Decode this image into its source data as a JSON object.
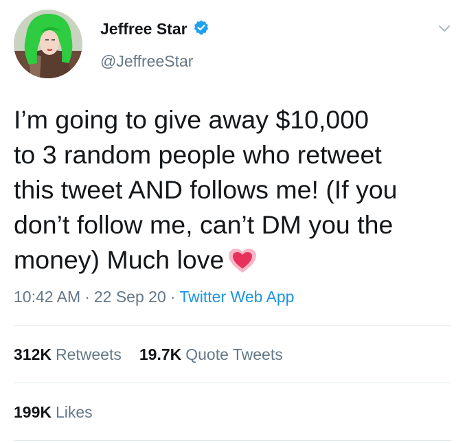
{
  "author": {
    "display_name": "Jeffree Star",
    "handle": "@JeffreeStar",
    "verified": true
  },
  "tweet": {
    "text": "I’m going to give away $10,000\nto 3 random people who retweet\nthis tweet AND follows me! (If you\ndon’t follow me, can’t DM you the\nmoney) Much love",
    "emoji": "heart-emoji",
    "time": "10:42 AM",
    "date": "22 Sep 20",
    "source": "Twitter Web App",
    "separator": "·"
  },
  "stats": {
    "retweets_count": "312K",
    "retweets_label": "Retweets",
    "quote_tweets_count": "19.7K",
    "quote_tweets_label": "Quote Tweets",
    "likes_count": "199K",
    "likes_label": "Likes"
  },
  "colors": {
    "text": "#14171a",
    "secondary": "#657786",
    "link": "#1b95e0",
    "verified": "#1da1f2",
    "divider": "#e1e8ed",
    "avatar_hair": "#2ecc40"
  },
  "icons": {
    "verified": "verified-badge-icon",
    "more": "chevron-down-icon"
  }
}
